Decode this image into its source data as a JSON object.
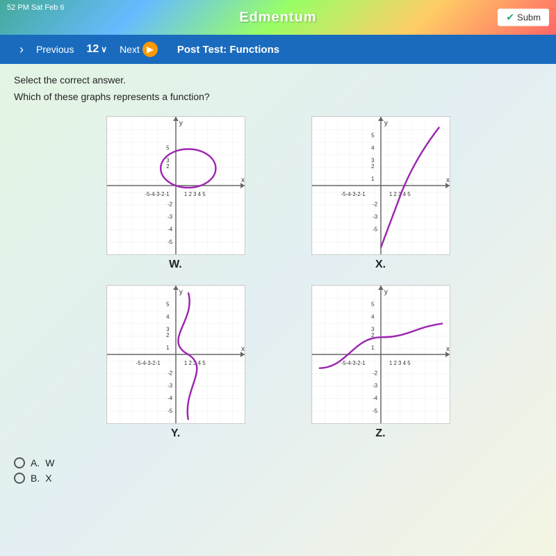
{
  "topbar": {
    "title": "Edmentum",
    "time_date": "52 PM  Sat Feb 6",
    "submit_label": "Subm"
  },
  "navbar": {
    "previous_label": "Previous",
    "question_number": "12",
    "chevron": "∨",
    "next_label": "Next",
    "test_title": "Post Test: Functions"
  },
  "content": {
    "instruction": "Select the correct answer.",
    "question": "Which of these graphs represents a function?",
    "graph_w_label": "W.",
    "graph_x_label": "X.",
    "graph_y_label": "Y.",
    "graph_z_label": "Z."
  },
  "answers": {
    "a_label": "A.",
    "a_value": "W",
    "b_label": "B.",
    "b_value": "X"
  }
}
